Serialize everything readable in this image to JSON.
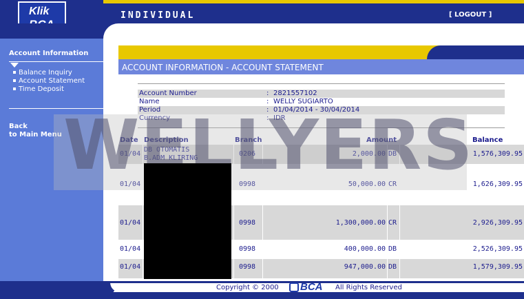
{
  "header": {
    "logo_line1": "Klik",
    "logo_line2": "BCA",
    "title": "INDIVIDUAL",
    "logout": "[ LOGOUT ]"
  },
  "sidebar": {
    "section_title": "Account Information",
    "items": [
      {
        "label": "Balance Inquiry"
      },
      {
        "label": "Account Statement"
      },
      {
        "label": "Time Deposit"
      }
    ],
    "back_line1": "Back",
    "back_line2": "to Main Menu"
  },
  "page": {
    "title": "ACCOUNT INFORMATION - ACCOUNT STATEMENT"
  },
  "account": [
    {
      "label": "Account Number",
      "value": "2821557102"
    },
    {
      "label": "Name",
      "value": "WELLY SUGIARTO"
    },
    {
      "label": "Period",
      "value": "01/04/2014 - 30/04/2014"
    },
    {
      "label": "Currency",
      "value": "IDR"
    }
  ],
  "table": {
    "headers": {
      "date": "Date",
      "description": "Description",
      "branch": "Branch",
      "amount": "Amount",
      "balance": "Balance"
    },
    "rows": [
      {
        "date": "01/04",
        "description_line1": "DB OTOMATIS",
        "description_line2": "B.ADM KLIRING",
        "branch": "0206",
        "amount": "2,000.00",
        "type": "DB",
        "balance": "1,576,309.95"
      },
      {
        "date": "01/04",
        "description_line1": "",
        "description_line2": "",
        "branch": "0998",
        "amount": "50,000.00",
        "type": "CR",
        "balance": "1,626,309.95"
      },
      {
        "date": "01/04",
        "description_line1": "",
        "description_line2": "",
        "branch": "0998",
        "amount": "1,300,000.00",
        "type": "CR",
        "balance": "2,926,309.95"
      },
      {
        "date": "01/04",
        "description_line1": "",
        "description_line2": "",
        "branch": "0998",
        "amount": "400,000.00",
        "type": "DB",
        "balance": "2,526,309.95"
      },
      {
        "date": "01/04",
        "description_line1": "",
        "description_line2": "",
        "branch": "0998",
        "amount": "947,000.00",
        "type": "DB",
        "balance": "1,579,309.95"
      }
    ]
  },
  "watermark": "WELLYERS",
  "footer": {
    "copyright": "Copyright © 2000",
    "brand": "BCA",
    "rights": "All Rights Reserved"
  },
  "colors": {
    "navy": "#1e2f8c",
    "sidebar_blue": "#5b7bd8",
    "title_blue": "#6f86dd",
    "yellow": "#e8c800",
    "row_gray": "#d8d8d8"
  }
}
